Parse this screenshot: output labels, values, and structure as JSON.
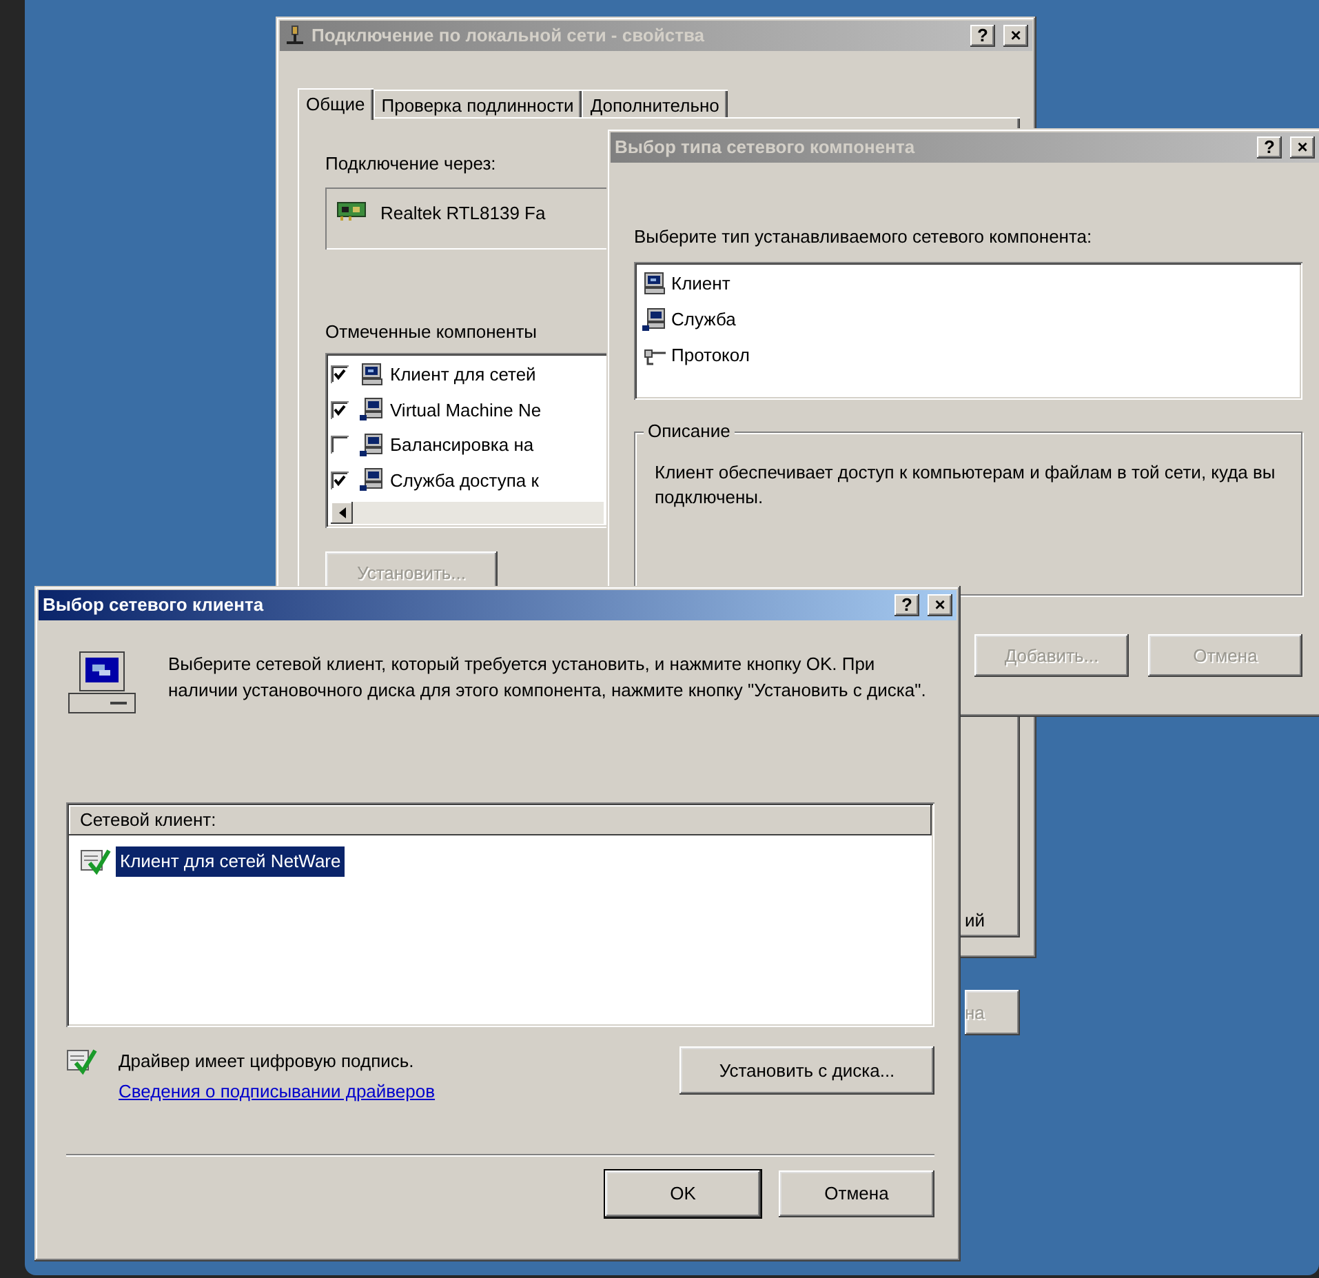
{
  "properties_window": {
    "title": "Подключение по локальной сети - свойства",
    "active": false,
    "caption_buttons": [
      {
        "kind": "help",
        "label": "?"
      },
      {
        "kind": "close",
        "label": "×"
      }
    ],
    "tabs": [
      {
        "label": "Общие",
        "selected": true
      },
      {
        "label": "Проверка подлинности",
        "selected": false
      },
      {
        "label": "Дополнительно",
        "selected": false
      }
    ],
    "connect_label": "Подключение через:",
    "adapter": "Realtek RTL8139 Fa",
    "components_label": "Отмеченные компоненты",
    "components": [
      {
        "label": "Клиент для сетей",
        "kind": "client",
        "checked": true
      },
      {
        "label": "Virtual Machine Ne",
        "kind": "service",
        "checked": true
      },
      {
        "label": "Балансировка на",
        "kind": "service",
        "checked": false
      },
      {
        "label": "Служба доступа к",
        "kind": "service",
        "checked": true
      }
    ],
    "install_button": {
      "label": "Установить...",
      "disabled": true
    },
    "cut_text": "ий",
    "cut_button": {
      "label": "на",
      "disabled": true
    }
  },
  "component_type_window": {
    "title": "Выбор типа сетевого компонента",
    "active": false,
    "caption_buttons": [
      {
        "kind": "help",
        "label": "?"
      },
      {
        "kind": "close",
        "label": "×"
      }
    ],
    "prompt": "Выберите тип устанавливаемого сетевого компонента:",
    "types": [
      {
        "label": "Клиент",
        "kind": "client"
      },
      {
        "label": "Служба",
        "kind": "service"
      },
      {
        "label": "Протокол",
        "kind": "protocol"
      }
    ],
    "description": {
      "legend": "Описание",
      "text": "Клиент обеспечивает доступ к компьютерам и файлам в той сети, куда вы подключены."
    },
    "buttons": [
      {
        "label": "Добавить...",
        "disabled": true
      },
      {
        "label": "Отмена",
        "disabled": true
      }
    ]
  },
  "client_window": {
    "title": "Выбор сетевого клиента",
    "active": true,
    "caption_buttons": [
      {
        "kind": "help",
        "label": "?"
      },
      {
        "kind": "close",
        "label": "×"
      }
    ],
    "instruction": "Выберите сетевой клиент, который требуется установить, и нажмите кнопку OK. При наличии установочного диска для этого компонента, нажмите кнопку \"Установить с диска\".",
    "list_header": "Сетевой клиент:",
    "clients": [
      {
        "label": "Клиент для сетей NetWare",
        "selected": true
      }
    ],
    "signature_text": "Драйвер имеет цифровую подпись.",
    "signature_link": "Сведения о подписывании драйверов",
    "disk_button": "Установить с диска...",
    "buttons": [
      {
        "label": "OK",
        "disabled": false
      },
      {
        "label": "Отмена",
        "disabled": false
      }
    ]
  }
}
